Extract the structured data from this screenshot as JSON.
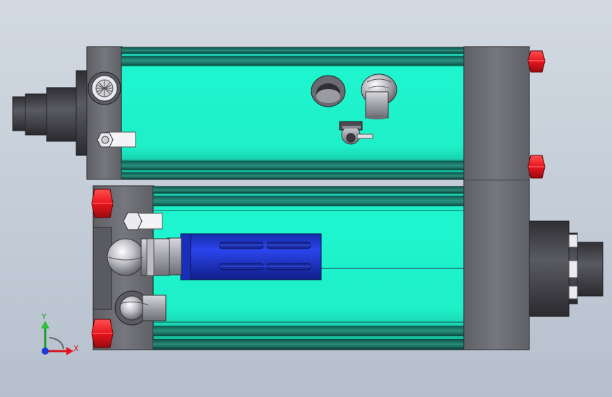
{
  "viewport": {
    "background_top": "#d2d9e2",
    "background_bottom": "#b6c0cd"
  },
  "colors": {
    "cylinder_body": "#1ef5cf",
    "cylinder_dark": "#0c6e5c",
    "end_plate": "#6a6a72",
    "hex_nut": "#e8141e",
    "piston": "#1f35d8",
    "steel": "#9a9aa2"
  },
  "triad": {
    "x_label": "X",
    "y_label": "Y",
    "icon": "axis-triad-icon"
  }
}
